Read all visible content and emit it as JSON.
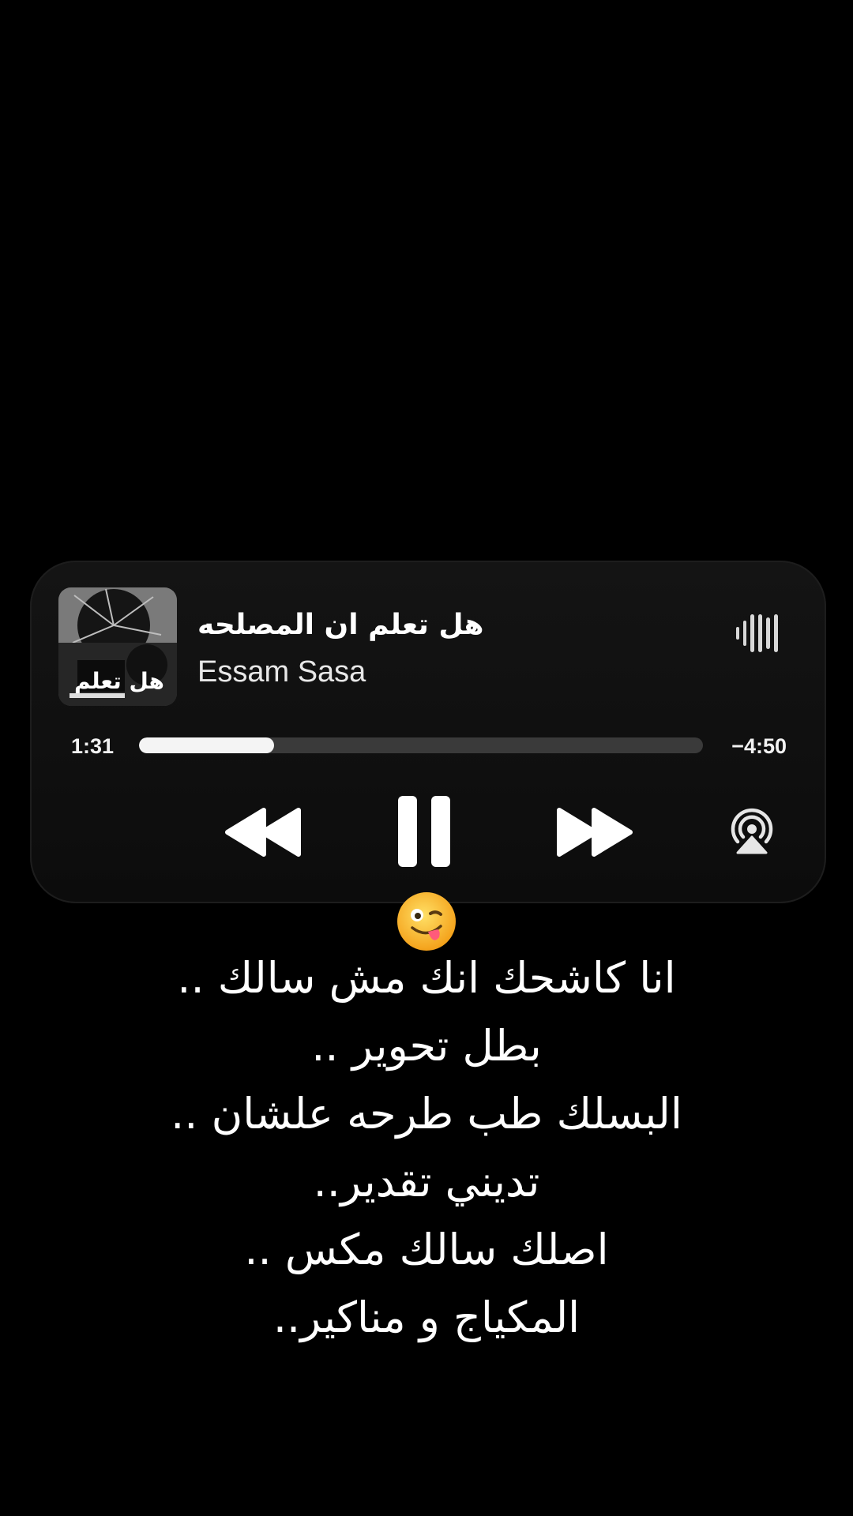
{
  "now_playing": {
    "title": "هل تعلم ان المصلحه",
    "artist": "Essam Sasa",
    "artwork_alt_text": "هل تعلم",
    "elapsed": "1:31",
    "remaining": "−4:50",
    "progress_fraction": 0.24
  },
  "controls": {
    "rewind": "rewind-icon",
    "pause": "pause-icon",
    "forward": "fast-forward-icon",
    "airplay": "airplay-icon",
    "waveform": "waveform-icon"
  },
  "emoji": "😜",
  "lyrics": [
    "انا كاشحك انك مش سالك ..",
    "بطل تحوير ..",
    "البسلك طب طرحه علشان ..",
    "تديني تقدير..",
    "اصلك سالك مكس ..",
    "المكياج و مناكير.."
  ],
  "colors": {
    "background": "#000000",
    "card": "#111111",
    "progress_track": "#3a3a3a",
    "progress_fill": "#f4f4f4",
    "text": "#ffffff"
  }
}
